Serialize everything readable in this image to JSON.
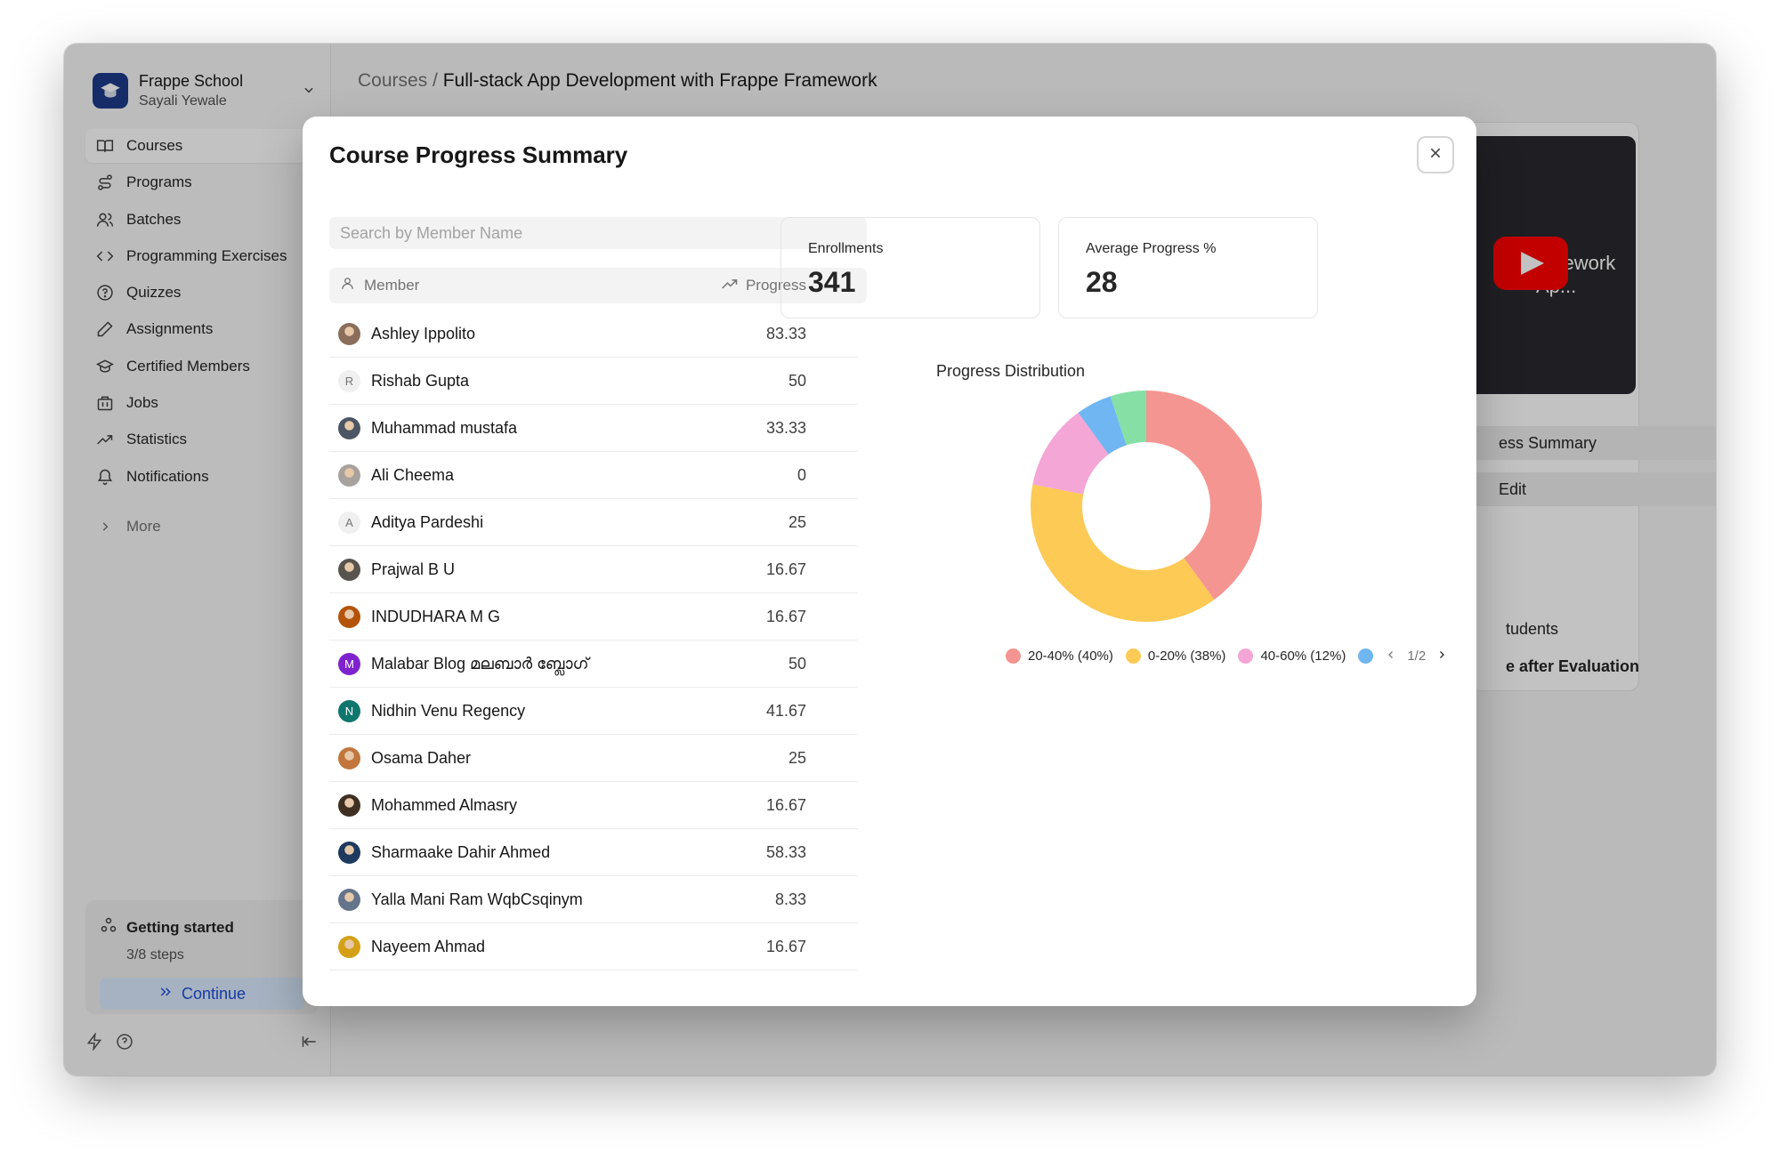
{
  "sidebar": {
    "org_name": "Frappe School",
    "user_name": "Sayali Yewale",
    "items": [
      {
        "label": "Courses",
        "icon": "book-icon",
        "active": true
      },
      {
        "label": "Programs",
        "icon": "route-icon"
      },
      {
        "label": "Batches",
        "icon": "users-icon"
      },
      {
        "label": "Programming Exercises",
        "icon": "code-icon"
      },
      {
        "label": "Quizzes",
        "icon": "help-circle-icon"
      },
      {
        "label": "Assignments",
        "icon": "pencil-icon"
      },
      {
        "label": "Certified Members",
        "icon": "graduation-cap-icon"
      },
      {
        "label": "Jobs",
        "icon": "building-icon"
      },
      {
        "label": "Statistics",
        "icon": "trending-up-icon"
      },
      {
        "label": "Notifications",
        "icon": "bell-icon"
      }
    ],
    "more_label": "More",
    "getting_started": {
      "title": "Getting started",
      "steps": "3/8 steps",
      "continue_label": "Continue"
    }
  },
  "breadcrumb": {
    "root": "Courses",
    "separator": "/",
    "current": "Full-stack App Development with Frappe Framework"
  },
  "background": {
    "video_title": "amework Ap...",
    "progress_summary_label": "ess Summary",
    "edit_label": "Edit",
    "students_label": "tudents",
    "evaluation_label": "e after Evaluation"
  },
  "modal": {
    "title": "Course Progress Summary",
    "search_placeholder": "Search by Member Name",
    "columns": {
      "member": "Member",
      "progress": "Progress"
    },
    "members": [
      {
        "name": "Ashley Ippolito",
        "progress": "83.33",
        "avatar": "photo",
        "color": "#8a6d5a"
      },
      {
        "name": "Rishab Gupta",
        "progress": "50",
        "avatar": "R",
        "color": "#f0f0f0"
      },
      {
        "name": "Muhammad mustafa",
        "progress": "33.33",
        "avatar": "photo",
        "color": "#4b5563"
      },
      {
        "name": "Ali Cheema",
        "progress": "0",
        "avatar": "photo",
        "color": "#a8a29e"
      },
      {
        "name": "Aditya Pardeshi",
        "progress": "25",
        "avatar": "A",
        "color": "#f0f0f0"
      },
      {
        "name": "Prajwal B U",
        "progress": "16.67",
        "avatar": "photo",
        "color": "#57534e"
      },
      {
        "name": "INDUDHARA M G",
        "progress": "16.67",
        "avatar": "photo",
        "color": "#b45309"
      },
      {
        "name": "Malabar Blog മലബാർ ബ്ലോഗ്",
        "progress": "50",
        "avatar": "M",
        "color": "#7e22ce"
      },
      {
        "name": "Nidhin Venu Regency",
        "progress": "41.67",
        "avatar": "N",
        "color": "#0f766e"
      },
      {
        "name": "Osama Daher",
        "progress": "25",
        "avatar": "photo",
        "color": "#c2763d"
      },
      {
        "name": "Mohammed Almasry",
        "progress": "16.67",
        "avatar": "photo",
        "color": "#3f2e22"
      },
      {
        "name": "Sharmaake Dahir Ahmed",
        "progress": "58.33",
        "avatar": "photo",
        "color": "#1e3a5f"
      },
      {
        "name": "Yalla Mani Ram WqbCsqinym",
        "progress": "8.33",
        "avatar": "photo",
        "color": "#64748b"
      },
      {
        "name": "Nayeem Ahmad",
        "progress": "16.67",
        "avatar": "photo",
        "color": "#d4a017"
      }
    ],
    "stats": [
      {
        "label": "Enrollments",
        "value": "341"
      },
      {
        "label": "Average Progress %",
        "value": "28"
      }
    ]
  },
  "chart_data": {
    "type": "pie",
    "title": "Progress Distribution",
    "donut": true,
    "slices": [
      {
        "label": "20-40%",
        "value": 40,
        "color": "#f59591"
      },
      {
        "label": "0-20%",
        "value": 38,
        "color": "#fcca55"
      },
      {
        "label": "40-60%",
        "value": 12,
        "color": "#f4a6d7"
      },
      {
        "label": "",
        "value": 5,
        "color": "#6fb6f2"
      },
      {
        "label": "",
        "value": 5,
        "color": "#86e0a6"
      }
    ],
    "legend": [
      {
        "text": "20-40% (40%)",
        "color": "#f59591"
      },
      {
        "text": "0-20% (38%)",
        "color": "#fcca55"
      },
      {
        "text": "40-60% (12%)",
        "color": "#f4a6d7"
      },
      {
        "text": "",
        "color": "#6fb6f2"
      }
    ],
    "legend_page": "1/2",
    "legend_placement": "bottom"
  }
}
